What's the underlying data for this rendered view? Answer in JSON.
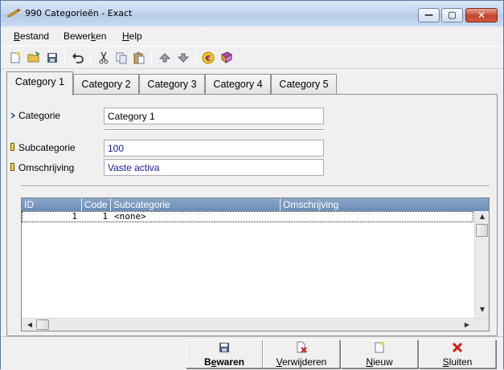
{
  "window": {
    "title": "990 Categorieën - Exact",
    "minimize_glyph": "—",
    "maximize_glyph": "▢",
    "close_glyph": "✕"
  },
  "menu": {
    "items": [
      {
        "label_first": "B",
        "label_rest": "estand"
      },
      {
        "label_first": "Bewer",
        "underline": "k",
        "label_rest": "en"
      },
      {
        "label_first": "H",
        "label_rest": "elp"
      }
    ]
  },
  "toolbar": {
    "icons": [
      "new-document-icon",
      "open-folder-icon",
      "save-icon",
      "undo-icon",
      "cut-icon",
      "copy-icon",
      "paste-icon",
      "move-up-icon",
      "move-down-icon",
      "euro-icon",
      "book-icon"
    ]
  },
  "tabs": [
    {
      "label": "Category 1",
      "active": true
    },
    {
      "label": "Category 2",
      "active": false
    },
    {
      "label": "Category 3",
      "active": false
    },
    {
      "label": "Category 4",
      "active": false
    },
    {
      "label": "Category 5",
      "active": false
    }
  ],
  "form": {
    "categorie_label": "Categorie",
    "categorie_value": "Category 1",
    "subcategorie_label": "Subcategorie",
    "subcategorie_value": "100",
    "omschrijving_label": "Omschrijving",
    "omschrijving_value": "Vaste activa"
  },
  "grid": {
    "columns": [
      "ID",
      "Code",
      "Subcategorie",
      "Omschrijving"
    ],
    "rows": [
      {
        "id": "1",
        "code": "1",
        "subcategorie": "<none>",
        "omschrijving": ""
      }
    ]
  },
  "buttons": {
    "bewaren": {
      "first": "B",
      "underline": "e",
      "rest": "waren"
    },
    "verwijderen": {
      "first": "",
      "underline": "V",
      "rest": "erwijderen"
    },
    "nieuw": {
      "first": "",
      "underline": "N",
      "rest": "ieuw"
    },
    "sluiten": {
      "first": "",
      "underline": "S",
      "rest": "luiten"
    }
  },
  "colors": {
    "grid_header": "#7a98bf",
    "close_button": "#c8472f",
    "field_value_blue": "#1a1aa8"
  }
}
